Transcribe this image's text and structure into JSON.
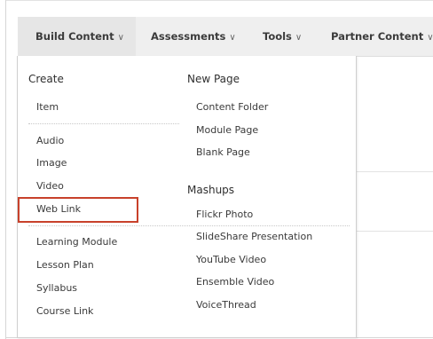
{
  "menubar": {
    "items": [
      {
        "label": "Build Content",
        "chevron": "∨"
      },
      {
        "label": "Assessments",
        "chevron": "∨"
      },
      {
        "label": "Tools",
        "chevron": "∨"
      },
      {
        "label": "Partner Content",
        "chevron": "∨"
      }
    ]
  },
  "dropdown": {
    "left_column": {
      "heading": "Create",
      "items": [
        "Item",
        "Audio",
        "Image",
        "Video",
        "Web Link",
        "Learning Module",
        "Lesson Plan",
        "Syllabus",
        "Course Link"
      ]
    },
    "right_column": {
      "new_page_heading": "New Page",
      "new_page_items": [
        "Content Folder",
        "Module Page",
        "Blank Page"
      ],
      "mashups_heading": "Mashups",
      "mashups_items": [
        "Flickr Photo",
        "SlideShare Presentation",
        "YouTube Video",
        "Ensemble Video",
        "VoiceThread"
      ]
    }
  },
  "highlight_color": "#c8412b"
}
